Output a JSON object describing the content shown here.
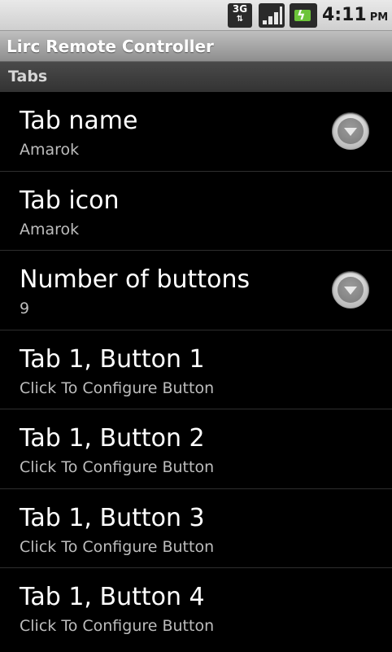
{
  "status_bar": {
    "network": "3G",
    "network_icon": "network-3g-icon",
    "signal_icon": "signal-strength-icon",
    "battery_icon": "battery-charging-icon",
    "time": "4:11",
    "ampm": "PM"
  },
  "app": {
    "title": "Lirc Remote Controller"
  },
  "category": {
    "title": "Tabs"
  },
  "preferences": [
    {
      "title": "Tab name",
      "summary": "Amarok",
      "has_dropdown": true,
      "dropdown_icon": "dropdown-arrow-icon"
    },
    {
      "title": "Tab icon",
      "summary": "Amarok",
      "has_dropdown": false
    },
    {
      "title": "Number of buttons",
      "summary": "9",
      "has_dropdown": true,
      "dropdown_icon": "dropdown-arrow-icon"
    },
    {
      "title": "Tab 1, Button 1",
      "summary": "Click To Configure Button",
      "has_dropdown": false
    },
    {
      "title": "Tab 1, Button 2",
      "summary": "Click To Configure Button",
      "has_dropdown": false
    },
    {
      "title": "Tab 1, Button 3",
      "summary": "Click To Configure Button",
      "has_dropdown": false
    },
    {
      "title": "Tab 1, Button 4",
      "summary": "Click To Configure Button",
      "has_dropdown": false
    }
  ],
  "colors": {
    "background": "#000000",
    "title_text": "#ffffff",
    "summary_text": "#bdbdbd",
    "battery_fill": "#6cc43a"
  }
}
